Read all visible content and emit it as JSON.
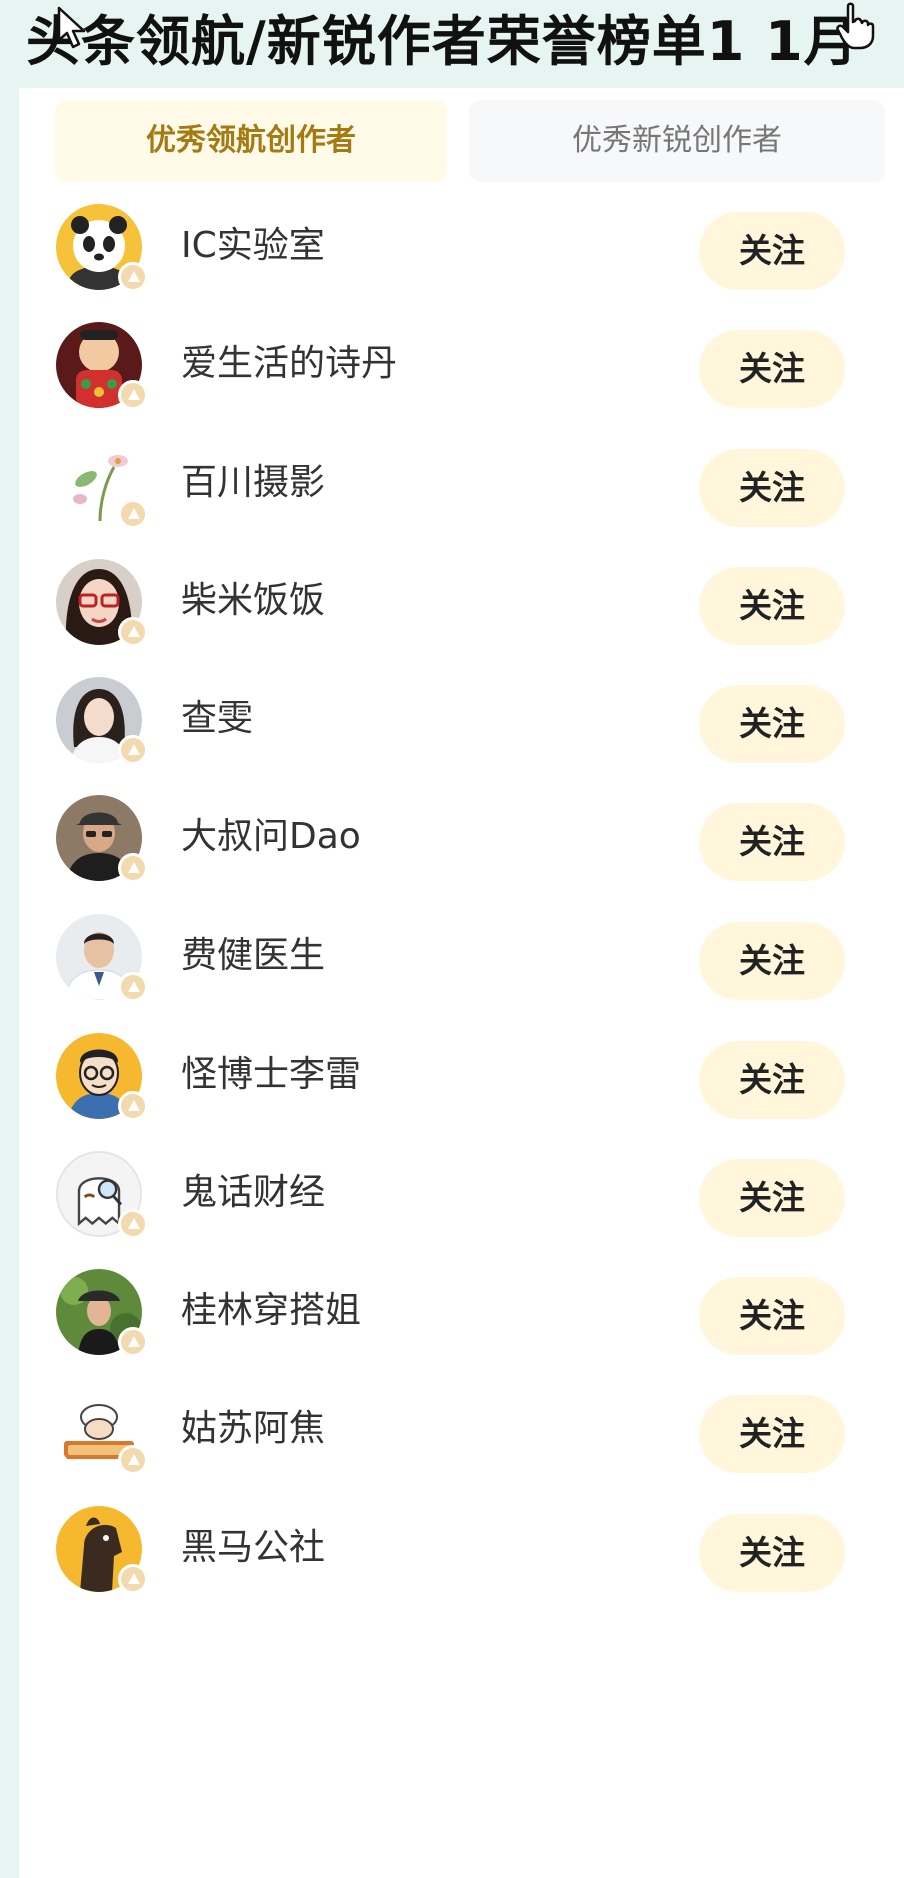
{
  "header": {
    "title": "头条领航/新锐作者荣誉榜单1 1月"
  },
  "tabs": [
    {
      "label": "优秀领航创作者",
      "active": true
    },
    {
      "label": "优秀新锐创作者",
      "active": false
    }
  ],
  "follow_label": "关注",
  "colors": {
    "page_bg": "#e6f5f2",
    "active_tab_text": "#a57a12",
    "active_tab_bg": "#fffbe8",
    "follow_bg": "#fff6dc",
    "badge": "#f3d9ae"
  },
  "creators": [
    {
      "name": "IC实验室",
      "avatar": "panda-avatar"
    },
    {
      "name": "爱生活的诗丹",
      "avatar": "doll-avatar"
    },
    {
      "name": "百川摄影",
      "avatar": "flower-avatar"
    },
    {
      "name": "柴米饭饭",
      "avatar": "woman-glasses-avatar"
    },
    {
      "name": "查雯",
      "avatar": "woman-avatar"
    },
    {
      "name": "大叔问Dao",
      "avatar": "man-cap-avatar"
    },
    {
      "name": "费健医生",
      "avatar": "doctor-avatar"
    },
    {
      "name": "怪博士李雷",
      "avatar": "cartoon-man-avatar"
    },
    {
      "name": "鬼话财经",
      "avatar": "ghost-avatar"
    },
    {
      "name": "桂林穿搭姐",
      "avatar": "woman-hat-avatar"
    },
    {
      "name": "姑苏阿焦",
      "avatar": "cartoon-chef-avatar"
    },
    {
      "name": "黑马公社",
      "avatar": "horse-avatar"
    }
  ]
}
